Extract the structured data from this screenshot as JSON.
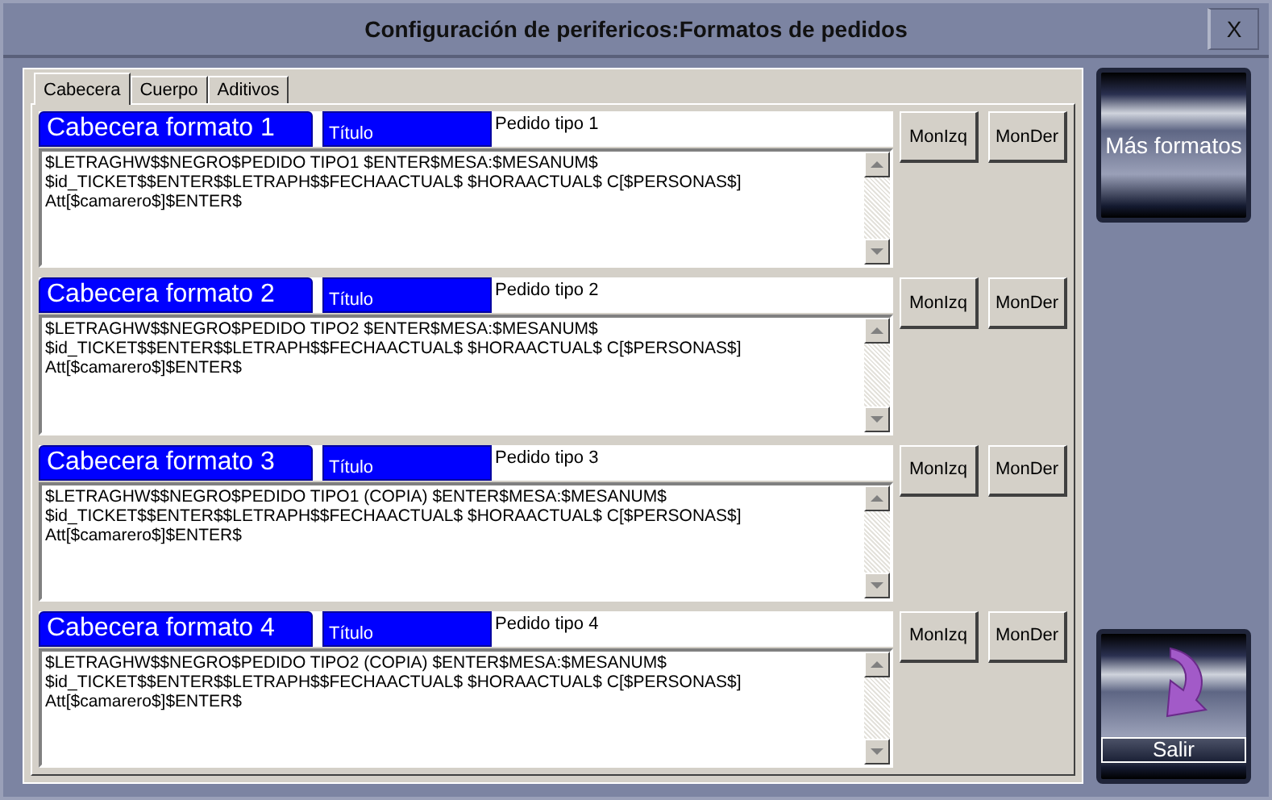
{
  "window": {
    "title": "Configuración de perifericos:Formatos de pedidos",
    "close_label": "X"
  },
  "tabs": [
    {
      "label": "Cabecera",
      "selected": true
    },
    {
      "label": "Cuerpo",
      "selected": false
    },
    {
      "label": "Aditivos",
      "selected": false
    }
  ],
  "formats": [
    {
      "name": "Cabecera formato 1",
      "title_label": "Título",
      "title_value": "Pedido tipo 1",
      "text": "$LETRAGHW$$NEGRO$PEDIDO TIPO1 $ENTER$MESA:$MESANUM$\n$id_TICKET$$ENTER$$LETRAPH$$FECHAACTUAL$ $HORAACTUAL$ C[$PERSONAS$]\nAtt[$camarero$]$ENTER$",
      "buttons": [
        "MonIzq",
        "MonDer"
      ]
    },
    {
      "name": "Cabecera formato 2",
      "title_label": "Título",
      "title_value": "Pedido tipo 2",
      "text": "$LETRAGHW$$NEGRO$PEDIDO TIPO2 $ENTER$MESA:$MESANUM$\n$id_TICKET$$ENTER$$LETRAPH$$FECHAACTUAL$ $HORAACTUAL$ C[$PERSONAS$]\nAtt[$camarero$]$ENTER$",
      "buttons": [
        "MonIzq",
        "MonDer"
      ]
    },
    {
      "name": "Cabecera formato 3",
      "title_label": "Título",
      "title_value": "Pedido tipo 3",
      "text": "$LETRAGHW$$NEGRO$PEDIDO TIPO1 (COPIA) $ENTER$MESA:$MESANUM$\n$id_TICKET$$ENTER$$LETRAPH$$FECHAACTUAL$ $HORAACTUAL$ C[$PERSONAS$]\nAtt[$camarero$]$ENTER$",
      "buttons": [
        "MonIzq",
        "MonDer"
      ]
    },
    {
      "name": "Cabecera formato 4",
      "title_label": "Título",
      "title_value": "Pedido tipo 4",
      "text": "$LETRAGHW$$NEGRO$PEDIDO TIPO2 (COPIA) $ENTER$MESA:$MESANUM$\n$id_TICKET$$ENTER$$LETRAPH$$FECHAACTUAL$ $HORAACTUAL$ C[$PERSONAS$]\nAtt[$camarero$]$ENTER$",
      "buttons": [
        "MonIzq",
        "MonDer"
      ]
    }
  ],
  "side_buttons": [
    {
      "label": "Más formatos",
      "kind": "text"
    },
    {
      "label": "Salir",
      "kind": "exit"
    }
  ]
}
